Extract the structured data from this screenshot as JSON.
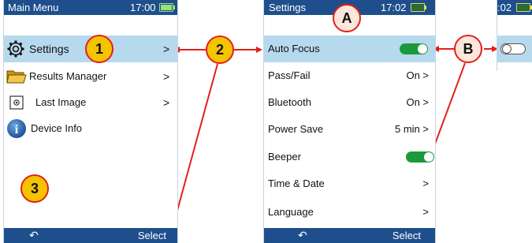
{
  "colors": {
    "titlebar": "#1e4f8c",
    "highlight": "#b7d9ee",
    "toggle_on": "#1b9a3a",
    "callout_border": "#e2201b",
    "callout_number_fill": "#f5c400",
    "callout_letter_fill": "#ffe6dc",
    "arrow": "#e2201b"
  },
  "screen1": {
    "title": "Main Menu",
    "time": "17:00",
    "battery_label": "100%",
    "items": [
      {
        "label": "Settings",
        "icon": "gear-icon",
        "chevron": ">"
      },
      {
        "label": "Results Manager",
        "icon": "folder-icon",
        "chevron": ">"
      },
      {
        "label": "Last Image",
        "icon": "image-icon",
        "chevron": ">"
      },
      {
        "label": "Device Info",
        "icon": "info-icon"
      }
    ],
    "back_glyph": "↶",
    "select_label": "Select"
  },
  "screen2": {
    "title": "Settings",
    "time": "17:02",
    "items": [
      {
        "label": "Auto Focus",
        "toggle": "on"
      },
      {
        "label": "Pass/Fail",
        "value": "On >"
      },
      {
        "label": "Bluetooth",
        "value": "On >"
      },
      {
        "label": "Power Save",
        "value": "5 min >"
      },
      {
        "label": "Beeper",
        "toggle": "on"
      },
      {
        "label": "Time & Date",
        "value": ">"
      },
      {
        "label": "Language",
        "value": ">"
      }
    ],
    "back_glyph": "↶",
    "select_label": "Select"
  },
  "screen3": {
    "time": ":02",
    "toggle": "off"
  },
  "callouts": {
    "c1": "1",
    "c2": "2",
    "c3": "3",
    "cA": "A",
    "cB": "B"
  }
}
